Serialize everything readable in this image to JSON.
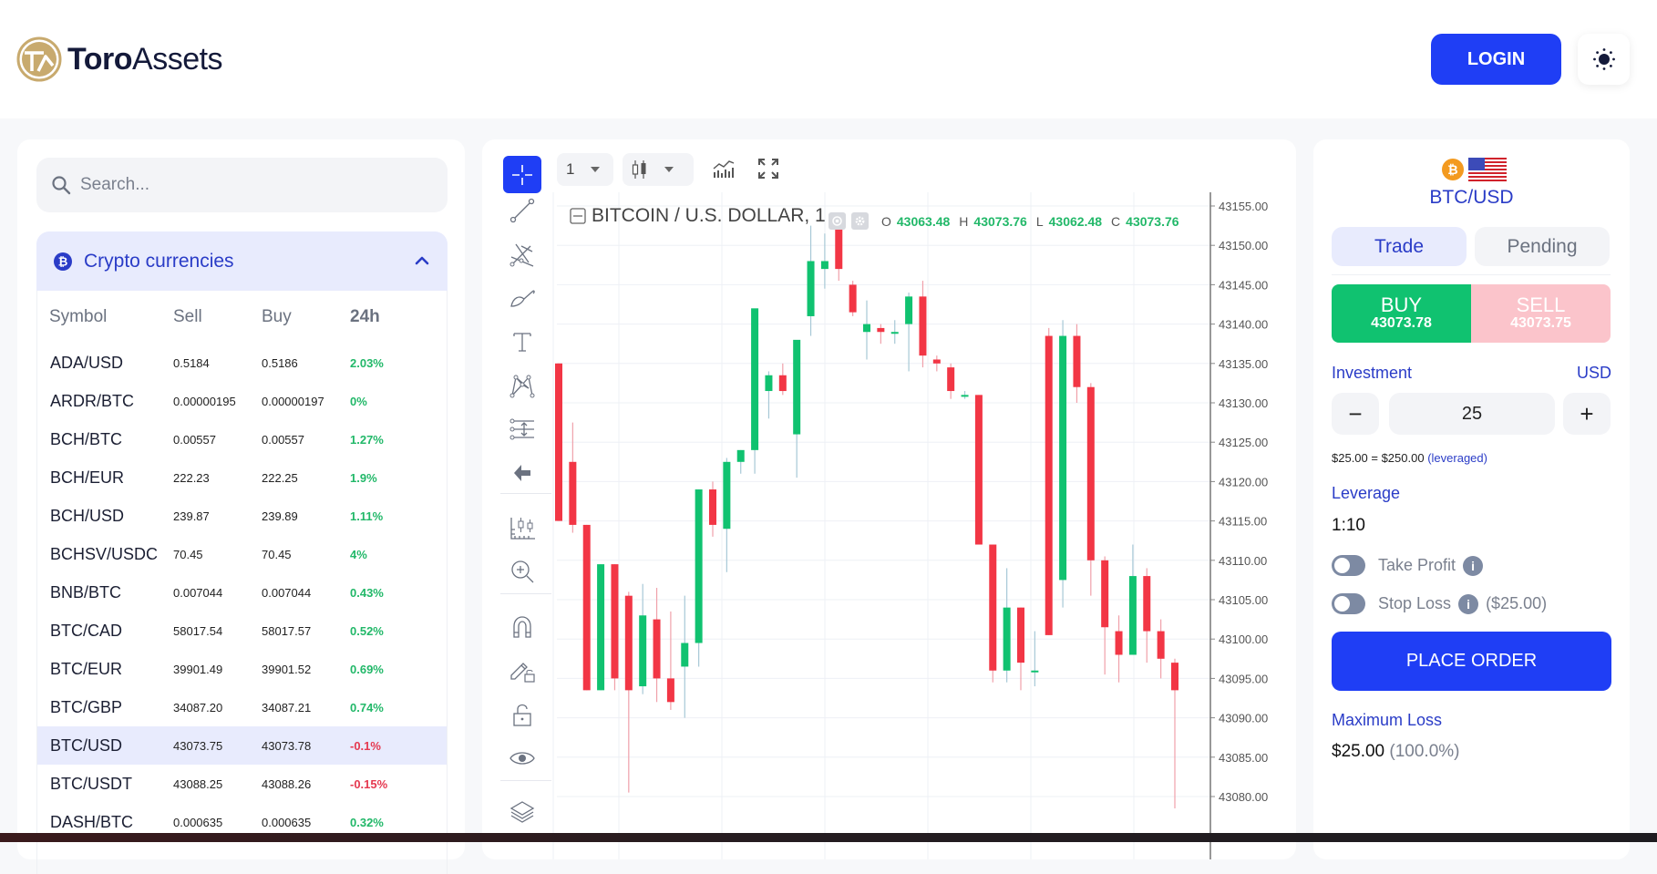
{
  "header": {
    "brand_bold": "Toro",
    "brand_light": "Assets",
    "login_label": "LOGIN",
    "theme_icon": "sun-icon"
  },
  "markets": {
    "search_placeholder": "Search...",
    "category_title": "Crypto currencies",
    "columns": [
      "Symbol",
      "Sell",
      "Buy",
      "24h"
    ],
    "rows": [
      {
        "symbol": "ADA/USD",
        "sell": "0.5184",
        "buy": "0.5186",
        "change": "2.03%",
        "dir": "pos"
      },
      {
        "symbol": "ARDR/BTC",
        "sell": "0.00000195",
        "buy": "0.00000197",
        "change": "0%",
        "dir": "pos"
      },
      {
        "symbol": "BCH/BTC",
        "sell": "0.00557",
        "buy": "0.00557",
        "change": "1.27%",
        "dir": "pos"
      },
      {
        "symbol": "BCH/EUR",
        "sell": "222.23",
        "buy": "222.25",
        "change": "1.9%",
        "dir": "pos"
      },
      {
        "symbol": "BCH/USD",
        "sell": "239.87",
        "buy": "239.89",
        "change": "1.11%",
        "dir": "pos"
      },
      {
        "symbol": "BCHSV/USDC",
        "sell": "70.45",
        "buy": "70.45",
        "change": "4%",
        "dir": "pos"
      },
      {
        "symbol": "BNB/BTC",
        "sell": "0.007044",
        "buy": "0.007044",
        "change": "0.43%",
        "dir": "pos"
      },
      {
        "symbol": "BTC/CAD",
        "sell": "58017.54",
        "buy": "58017.57",
        "change": "0.52%",
        "dir": "pos"
      },
      {
        "symbol": "BTC/EUR",
        "sell": "39901.49",
        "buy": "39901.52",
        "change": "0.69%",
        "dir": "pos"
      },
      {
        "symbol": "BTC/GBP",
        "sell": "34087.20",
        "buy": "34087.21",
        "change": "0.74%",
        "dir": "pos"
      },
      {
        "symbol": "BTC/USD",
        "sell": "43073.75",
        "buy": "43073.78",
        "change": "-0.1%",
        "dir": "neg",
        "selected": true
      },
      {
        "symbol": "BTC/USDT",
        "sell": "43088.25",
        "buy": "43088.26",
        "change": "-0.15%",
        "dir": "neg"
      },
      {
        "symbol": "DASH/BTC",
        "sell": "0.000635",
        "buy": "0.000635",
        "change": "0.32%",
        "dir": "pos"
      }
    ]
  },
  "chart_toolbar": {
    "interval": "1",
    "chart_type_icon": "candles-icon",
    "indicators_icon": "indicators-icon",
    "fullscreen_icon": "fullscreen-icon"
  },
  "chart_data": {
    "type": "candlestick",
    "title": "BITCOIN / U.S. DOLLAR, 1",
    "ohlc_legend": {
      "O": "43063.48",
      "H": "43073.76",
      "L": "43062.48",
      "C": "43073.76"
    },
    "ylim": [
      43077,
      43158
    ],
    "y_ticks": [
      "43155.00",
      "43150.00",
      "43145.00",
      "43140.00",
      "43135.00",
      "43130.00",
      "43125.00",
      "43120.00",
      "43115.00",
      "43110.00",
      "43105.00",
      "43100.00",
      "43095.00",
      "43090.00",
      "43085.00",
      "43080.00"
    ],
    "grid": true,
    "candles": [
      {
        "o": 43135.0,
        "h": 43135.0,
        "l": 43115.0,
        "c": 43115.0
      },
      {
        "o": 43122.5,
        "h": 43127.5,
        "l": 43113.5,
        "c": 43114.5
      },
      {
        "o": 43114.5,
        "h": 43114.5,
        "l": 43093.5,
        "c": 43093.5
      },
      {
        "o": 43093.5,
        "h": 43109.5,
        "l": 43093.5,
        "c": 43109.5
      },
      {
        "o": 43109.5,
        "h": 43109.5,
        "l": 43093.5,
        "c": 43095.0
      },
      {
        "o": 43105.5,
        "h": 43106.0,
        "l": 43080.5,
        "c": 43093.5
      },
      {
        "o": 43094.0,
        "h": 43107.0,
        "l": 43093.0,
        "c": 43103.0
      },
      {
        "o": 43102.5,
        "h": 43106.5,
        "l": 43092.0,
        "c": 43095.0
      },
      {
        "o": 43095.0,
        "h": 43103.5,
        "l": 43091.0,
        "c": 43092.0
      },
      {
        "o": 43096.5,
        "h": 43105.5,
        "l": 43090.0,
        "c": 43099.5
      },
      {
        "o": 43099.5,
        "h": 43119.0,
        "l": 43096.5,
        "c": 43119.0
      },
      {
        "o": 43119.0,
        "h": 43120.0,
        "l": 43113.0,
        "c": 43114.5
      },
      {
        "o": 43114.0,
        "h": 43123.0,
        "l": 43108.5,
        "c": 43122.5
      },
      {
        "o": 43122.5,
        "h": 43124.0,
        "l": 43121.0,
        "c": 43124.0
      },
      {
        "o": 43124.0,
        "h": 43132.5,
        "l": 43121.0,
        "c": 43142.0
      },
      {
        "o": 43131.5,
        "h": 43134.0,
        "l": 43128.0,
        "c": 43133.5
      },
      {
        "o": 43133.5,
        "h": 43135.0,
        "l": 43131.0,
        "c": 43131.5
      },
      {
        "o": 43126.0,
        "h": 43137.0,
        "l": 43120.5,
        "c": 43138.0
      },
      {
        "o": 43141.0,
        "h": 43152.5,
        "l": 43138.5,
        "c": 43148.0
      },
      {
        "o": 43147.0,
        "h": 43151.5,
        "l": 43144.5,
        "c": 43148.0
      },
      {
        "o": 43152.0,
        "h": 43152.0,
        "l": 43145.5,
        "c": 43147.0
      },
      {
        "o": 43145.0,
        "h": 43145.5,
        "l": 43141.0,
        "c": 43141.5
      },
      {
        "o": 43139.0,
        "h": 43143.0,
        "l": 43135.5,
        "c": 43140.0
      },
      {
        "o": 43139.5,
        "h": 43140.0,
        "l": 43137.5,
        "c": 43139.0
      },
      {
        "o": 43139.0,
        "h": 43140.5,
        "l": 43137.5,
        "c": 43139.0
      },
      {
        "o": 43140.0,
        "h": 43144.0,
        "l": 43134.0,
        "c": 43143.5
      },
      {
        "o": 43143.5,
        "h": 43145.5,
        "l": 43134.5,
        "c": 43136.0
      },
      {
        "o": 43135.5,
        "h": 43136.0,
        "l": 43134.0,
        "c": 43135.0
      },
      {
        "o": 43134.5,
        "h": 43135.0,
        "l": 43130.5,
        "c": 43131.5
      },
      {
        "o": 43131.0,
        "h": 43131.5,
        "l": 43130.5,
        "c": 43131.0
      },
      {
        "o": 43131.0,
        "h": 43131.0,
        "l": 43112.0,
        "c": 43112.0
      },
      {
        "o": 43112.0,
        "h": 43112.0,
        "l": 43094.5,
        "c": 43096.0
      },
      {
        "o": 43096.0,
        "h": 43109.0,
        "l": 43094.5,
        "c": 43104.0
      },
      {
        "o": 43104.0,
        "h": 43104.0,
        "l": 43093.5,
        "c": 43097.0
      },
      {
        "o": 43096.0,
        "h": 43101.0,
        "l": 43094.0,
        "c": 43096.0
      },
      {
        "o": 43138.5,
        "h": 43139.5,
        "l": 43100.5,
        "c": 43100.5
      },
      {
        "o": 43107.5,
        "h": 43140.5,
        "l": 43104.0,
        "c": 43138.5
      },
      {
        "o": 43138.5,
        "h": 43140.0,
        "l": 43130.0,
        "c": 43132.0
      },
      {
        "o": 43132.0,
        "h": 43132.5,
        "l": 43105.5,
        "c": 43110.0
      },
      {
        "o": 43110.0,
        "h": 43110.5,
        "l": 43095.5,
        "c": 43101.5
      },
      {
        "o": 43101.0,
        "h": 43103.0,
        "l": 43094.5,
        "c": 43098.0
      },
      {
        "o": 43098.0,
        "h": 43112.0,
        "l": 43098.0,
        "c": 43108.0
      },
      {
        "o": 43108.0,
        "h": 43109.0,
        "l": 43097.0,
        "c": 43101.0
      },
      {
        "o": 43101.0,
        "h": 43102.5,
        "l": 43095.0,
        "c": 43097.5
      },
      {
        "o": 43097.0,
        "h": 43097.5,
        "l": 43078.5,
        "c": 43093.5
      }
    ]
  },
  "trade": {
    "pair": "BTC/USD",
    "tabs": {
      "trade": "Trade",
      "pending": "Pending"
    },
    "buy_label": "BUY",
    "buy_price": "43073.78",
    "sell_label": "SELL",
    "sell_price": "43073.75",
    "investment_label": "Investment",
    "currency": "USD",
    "minus": "−",
    "plus": "+",
    "amount": "25",
    "leverage_summary": "$25.00 = $250.00",
    "leverage_note": "(leveraged)",
    "leverage_label": "Leverage",
    "leverage_value": "1:10",
    "take_profit_label": "Take Profit",
    "stop_loss_label": "Stop Loss",
    "stop_loss_amount": "($25.00)",
    "info_glyph": "i",
    "place_order_label": "PLACE ORDER",
    "max_loss_label": "Maximum Loss",
    "max_loss_value": "$25.00",
    "max_loss_pct": "(100.0%)",
    "take_profit_on": false,
    "stop_loss_on": false
  },
  "colors": {
    "accent": "#1f3ef5",
    "up": "#10c270",
    "down": "#f23645"
  }
}
